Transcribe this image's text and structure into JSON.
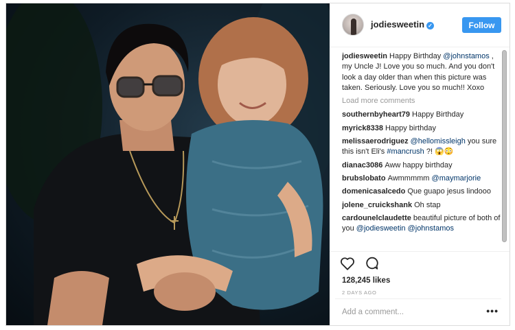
{
  "post": {
    "username": "jodiesweetin",
    "verified_mark": "✓",
    "follow_label": "Follow",
    "load_more_label": "Load more comments",
    "likes": "128,245 likes",
    "time": "2 DAYS AGO",
    "add_comment_placeholder": "Add a comment...",
    "more_options": "•••",
    "verified_color": "#3897f0",
    "mention_color": "#003569"
  },
  "comments": [
    {
      "user": "jodiesweetin",
      "parts": [
        {
          "t": "Happy Birthday "
        },
        {
          "t": "@johnstamos",
          "m": true
        },
        {
          "t": " , my Uncle J! Love you so much. And you don't look a day older than when this picture was taken. Seriously. Love you so much!! Xoxo"
        }
      ]
    },
    {
      "user": "southernbyheart79",
      "parts": [
        {
          "t": "Happy Birthday"
        }
      ]
    },
    {
      "user": "myrick8338",
      "parts": [
        {
          "t": "Happy birthday"
        }
      ]
    },
    {
      "user": "melissaerodriguez",
      "parts": [
        {
          "t": "@hellomissleigh",
          "m": true
        },
        {
          "t": " you sure this isn't Eli's "
        },
        {
          "t": "#mancrush",
          "m": true
        },
        {
          "t": " ?! 😱😳"
        }
      ]
    },
    {
      "user": "dianac3086",
      "parts": [
        {
          "t": "Aww happy birthday"
        }
      ]
    },
    {
      "user": "brubslobato",
      "parts": [
        {
          "t": "Awmmmmm "
        },
        {
          "t": "@maymarjorie",
          "m": true
        }
      ]
    },
    {
      "user": "domenicasalcedo",
      "parts": [
        {
          "t": "Que guapo jesus lindooo"
        }
      ]
    },
    {
      "user": "jolene_cruickshank",
      "parts": [
        {
          "t": "Oh stap"
        }
      ]
    },
    {
      "user": "cardounelclaudette",
      "parts": [
        {
          "t": "beautiful picture of both of you "
        },
        {
          "t": "@jodiesweetin",
          "m": true
        },
        {
          "t": " "
        },
        {
          "t": "@johnstamos",
          "m": true
        }
      ]
    }
  ],
  "icons": {
    "like": "heart-icon",
    "comment": "comment-icon",
    "avatar": "avatar"
  }
}
